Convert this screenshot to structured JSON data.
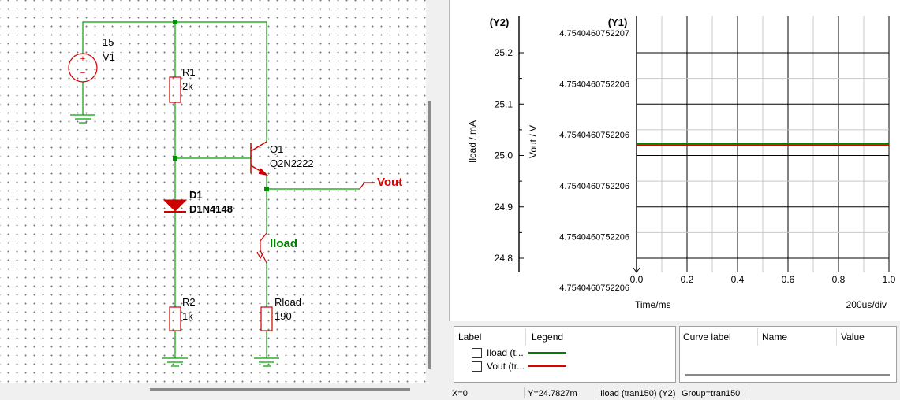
{
  "schematic": {
    "v1": {
      "value": "15",
      "name": "V1"
    },
    "r1": {
      "name": "R1",
      "value": "2k"
    },
    "q1": {
      "name": "Q1",
      "model": "Q2N2222"
    },
    "d1": {
      "name": "D1",
      "model": "D1N4148"
    },
    "r2": {
      "name": "R2",
      "value": "1k"
    },
    "rload": {
      "name": "Rload",
      "value": "190"
    },
    "vout_label": "Vout",
    "iload_label": "Iload",
    "colors": {
      "wire": "#00a000",
      "part": "#cc0000",
      "node": "#009000",
      "vout": "#e00000",
      "iload": "#008000"
    }
  },
  "plot": {
    "y2_title": "(Y2)",
    "y1_title": "(Y1)",
    "y2_axis_label": "Iload / mA",
    "y1_axis_label": "Vout / V",
    "y2_ticks": [
      "25.2",
      "25.1",
      "25.0",
      "24.9",
      "24.8"
    ],
    "y1_ticks": [
      "4.7540460752207",
      "4.7540460752206",
      "4.7540460752206",
      "4.7540460752206",
      "4.7540460752206",
      "4.7540460752206"
    ],
    "x_ticks": [
      "0.0",
      "0.2",
      "0.4",
      "0.6",
      "0.8",
      "1.0"
    ],
    "x_axis_label": "Time/ms",
    "x_div_label": "200us/div"
  },
  "chart_data": {
    "type": "line",
    "xlabel": "Time/ms",
    "ylabel": "Iload / mA",
    "xlim": [
      0.0,
      1.0
    ],
    "ylim": [
      24.8,
      25.2
    ],
    "series": [
      {
        "name": "Iload (t...",
        "color": "#008000",
        "x": [
          0.0,
          0.2,
          0.4,
          0.6,
          0.8,
          1.0
        ],
        "values": [
          25.022,
          25.022,
          25.022,
          25.022,
          25.022,
          25.022
        ]
      },
      {
        "name": "Vout (tr...",
        "color": "#e00000",
        "x": [
          0.0,
          0.2,
          0.4,
          0.6,
          0.8,
          1.0
        ],
        "values": [
          25.022,
          25.022,
          25.022,
          25.022,
          25.022,
          25.022
        ]
      }
    ]
  },
  "legend_panel": {
    "col_label": "Label",
    "col_legend": "Legend",
    "items": [
      {
        "label": "Iload (t...",
        "color": "#008000"
      },
      {
        "label": "Vout (tr...",
        "color": "#e00000"
      }
    ]
  },
  "curve_panel": {
    "col_curve_label": "Curve label",
    "col_name": "Name",
    "col_value": "Value"
  },
  "status_bar": {
    "x": "X=0",
    "y": "Y=24.7827m",
    "curve": "Iload (tran150) (Y2)",
    "group": "Group=tran150"
  }
}
